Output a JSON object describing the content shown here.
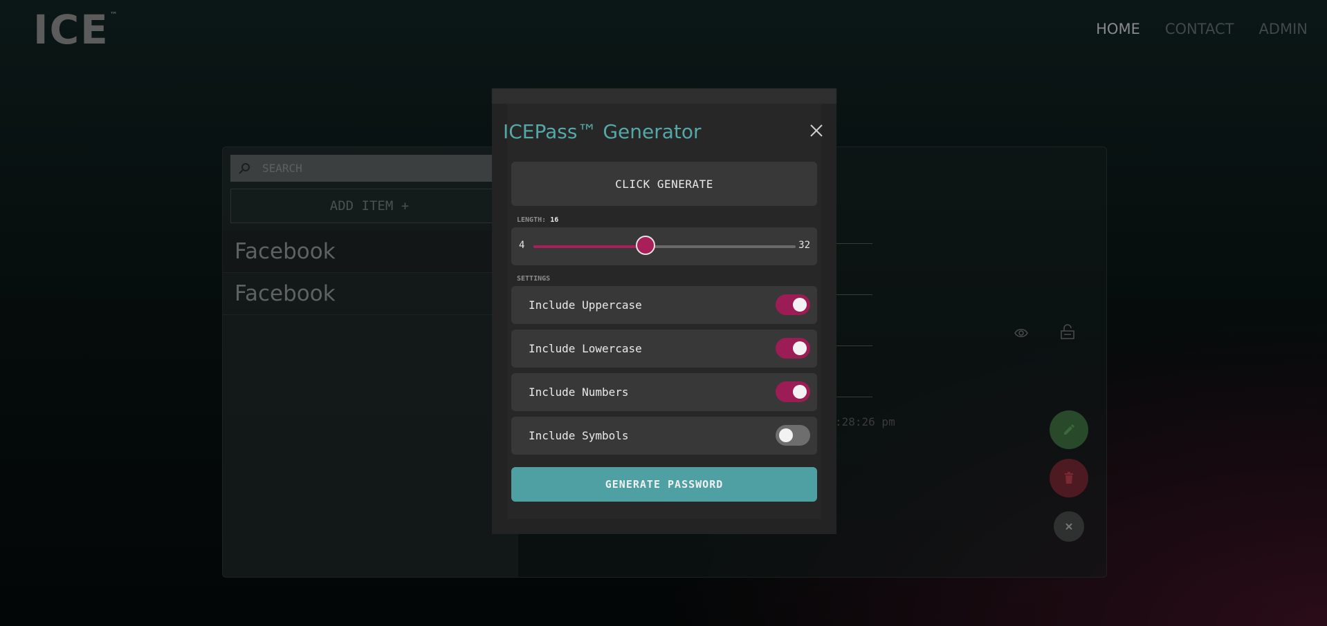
{
  "header": {
    "logo_text": "ICE",
    "logo_tm": "™",
    "nav": [
      {
        "label": "HOME"
      },
      {
        "label": "CONTACT"
      },
      {
        "label": "ADMIN"
      }
    ]
  },
  "page": {
    "title_left": "/",
    "title_right": "/"
  },
  "vault": {
    "search_placeholder": "SEARCH",
    "add_item_label": "ADD ITEM +",
    "items": [
      {
        "label": "Facebook"
      },
      {
        "label": "Facebook"
      }
    ],
    "timestamp_fragment": ":28:26 pm"
  },
  "modal": {
    "title": "ICEPass™ Generator",
    "output_text": "CLICK GENERATE",
    "length_label": "LENGTH:",
    "length_value": "16",
    "length": 16,
    "min_label": "4",
    "max_label": "32",
    "min": 4,
    "max": 32,
    "settings_label": "SETTINGS",
    "settings": [
      {
        "label": "Include Uppercase",
        "on": true
      },
      {
        "label": "Include Lowercase",
        "on": true
      },
      {
        "label": "Include Numbers",
        "on": true
      },
      {
        "label": "Include Symbols",
        "on": false
      }
    ],
    "generate_label": "GENERATE PASSWORD"
  },
  "colors": {
    "accent_teal": "#4fa0a2",
    "accent_magenta": "#a81f5a",
    "edit_green": "#284a2a",
    "delete_red": "#4c1a20"
  }
}
